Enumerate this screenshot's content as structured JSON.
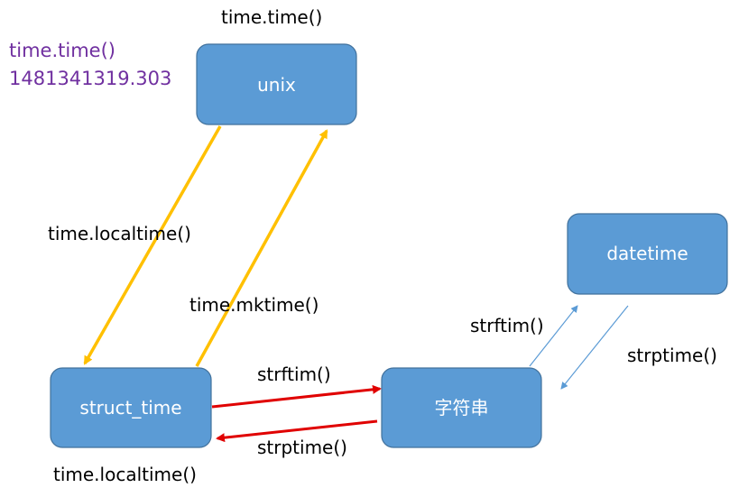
{
  "nodes": {
    "unix": "unix",
    "struct_time": "struct_time",
    "string": "字符串",
    "datetime": "datetime"
  },
  "labels": {
    "top_time_time": "time.time()",
    "side_time_time": "time.time()",
    "side_timestamp": "1481341319.303",
    "localtime_left": "time.localtime()",
    "mktime": "time.mktime()",
    "strftim_bottom": "strftim()",
    "strptime_bottom": "strptime()",
    "strftim_right": "strftim()",
    "strptime_right": "strptime()",
    "localtime_bottom": "time.localtime()"
  },
  "colors": {
    "box_fill": "#5b9bd5",
    "arrow_gold": "#ffc000",
    "arrow_red": "#e00000",
    "arrow_blue": "#5b9bd5",
    "accent_purple": "#7030a0"
  }
}
